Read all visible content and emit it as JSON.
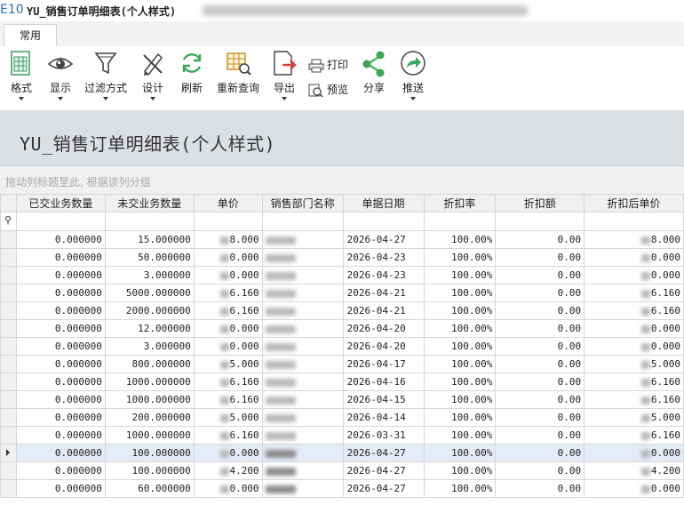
{
  "app": {
    "badge": "E10",
    "window_title": "YU_销售订单明细表(个人样式)"
  },
  "tabs": [
    {
      "label": "常用"
    }
  ],
  "ribbon": {
    "format": "格式",
    "display": "显示",
    "filter": "过滤方式",
    "design": "设计",
    "refresh": "刷新",
    "requery": "重新查询",
    "export": "导出",
    "print": "打印",
    "preview": "预览",
    "share": "分享",
    "push": "推送"
  },
  "report": {
    "title": "YU_销售订单明细表(个人样式)",
    "group_hint": "拖动列标题至此, 根据该列分组"
  },
  "grid": {
    "columns": [
      "已交业务数量",
      "未交业务数量",
      "单价",
      "销售部门名称",
      "单据日期",
      "折扣率",
      "折扣额",
      "折扣后单价"
    ],
    "selected_row_index": 12,
    "rows": [
      {
        "delivered": "0.000000",
        "undelivered": "15.000000",
        "price": "8.000",
        "date": "2026-04-27",
        "rate": "100.00%",
        "discount": "0.00",
        "after": "8.000"
      },
      {
        "delivered": "0.000000",
        "undelivered": "50.000000",
        "price": "0.000",
        "date": "2026-04-23",
        "rate": "100.00%",
        "discount": "0.00",
        "after": "0.000"
      },
      {
        "delivered": "0.000000",
        "undelivered": "3.000000",
        "price": "0.000",
        "date": "2026-04-23",
        "rate": "100.00%",
        "discount": "0.00",
        "after": "0.000"
      },
      {
        "delivered": "0.000000",
        "undelivered": "5000.000000",
        "price": "6.160",
        "date": "2026-04-21",
        "rate": "100.00%",
        "discount": "0.00",
        "after": "6.160"
      },
      {
        "delivered": "0.000000",
        "undelivered": "2000.000000",
        "price": "6.160",
        "date": "2026-04-21",
        "rate": "100.00%",
        "discount": "0.00",
        "after": "6.160"
      },
      {
        "delivered": "0.000000",
        "undelivered": "12.000000",
        "price": "0.000",
        "date": "2026-04-20",
        "rate": "100.00%",
        "discount": "0.00",
        "after": "0.000"
      },
      {
        "delivered": "0.000000",
        "undelivered": "3.000000",
        "price": "0.000",
        "date": "2026-04-20",
        "rate": "100.00%",
        "discount": "0.00",
        "after": "0.000"
      },
      {
        "delivered": "0.000000",
        "undelivered": "800.000000",
        "price": "5.000",
        "date": "2026-04-17",
        "rate": "100.00%",
        "discount": "0.00",
        "after": "5.000"
      },
      {
        "delivered": "0.000000",
        "undelivered": "1000.000000",
        "price": "6.160",
        "date": "2026-04-16",
        "rate": "100.00%",
        "discount": "0.00",
        "after": "6.160"
      },
      {
        "delivered": "0.000000",
        "undelivered": "1000.000000",
        "price": "6.160",
        "date": "2026-04-15",
        "rate": "100.00%",
        "discount": "0.00",
        "after": "6.160"
      },
      {
        "delivered": "0.000000",
        "undelivered": "200.000000",
        "price": "5.000",
        "date": "2026-04-14",
        "rate": "100.00%",
        "discount": "0.00",
        "after": "5.000"
      },
      {
        "delivered": "0.000000",
        "undelivered": "1000.000000",
        "price": "6.160",
        "date": "2026-03-31",
        "rate": "100.00%",
        "discount": "0.00",
        "after": "6.160"
      },
      {
        "delivered": "0.000000",
        "undelivered": "100.000000",
        "price": "0.000",
        "date": "2026-04-27",
        "rate": "100.00%",
        "discount": "0.00",
        "after": "0.000"
      },
      {
        "delivered": "0.000000",
        "undelivered": "100.000000",
        "price": "4.200",
        "date": "2026-04-27",
        "rate": "100.00%",
        "discount": "0.00",
        "after": "4.200"
      },
      {
        "delivered": "0.000000",
        "undelivered": "60.000000",
        "price": "0.000",
        "date": "2026-04-27",
        "rate": "100.00%",
        "discount": "0.00",
        "after": "0.000"
      }
    ]
  },
  "colors": {
    "accent": "#2b6cc4",
    "header_band": "#dcdfe3",
    "selected_row": "#e3ecf8",
    "share_green": "#3aa757",
    "export_red": "#d9423a"
  }
}
